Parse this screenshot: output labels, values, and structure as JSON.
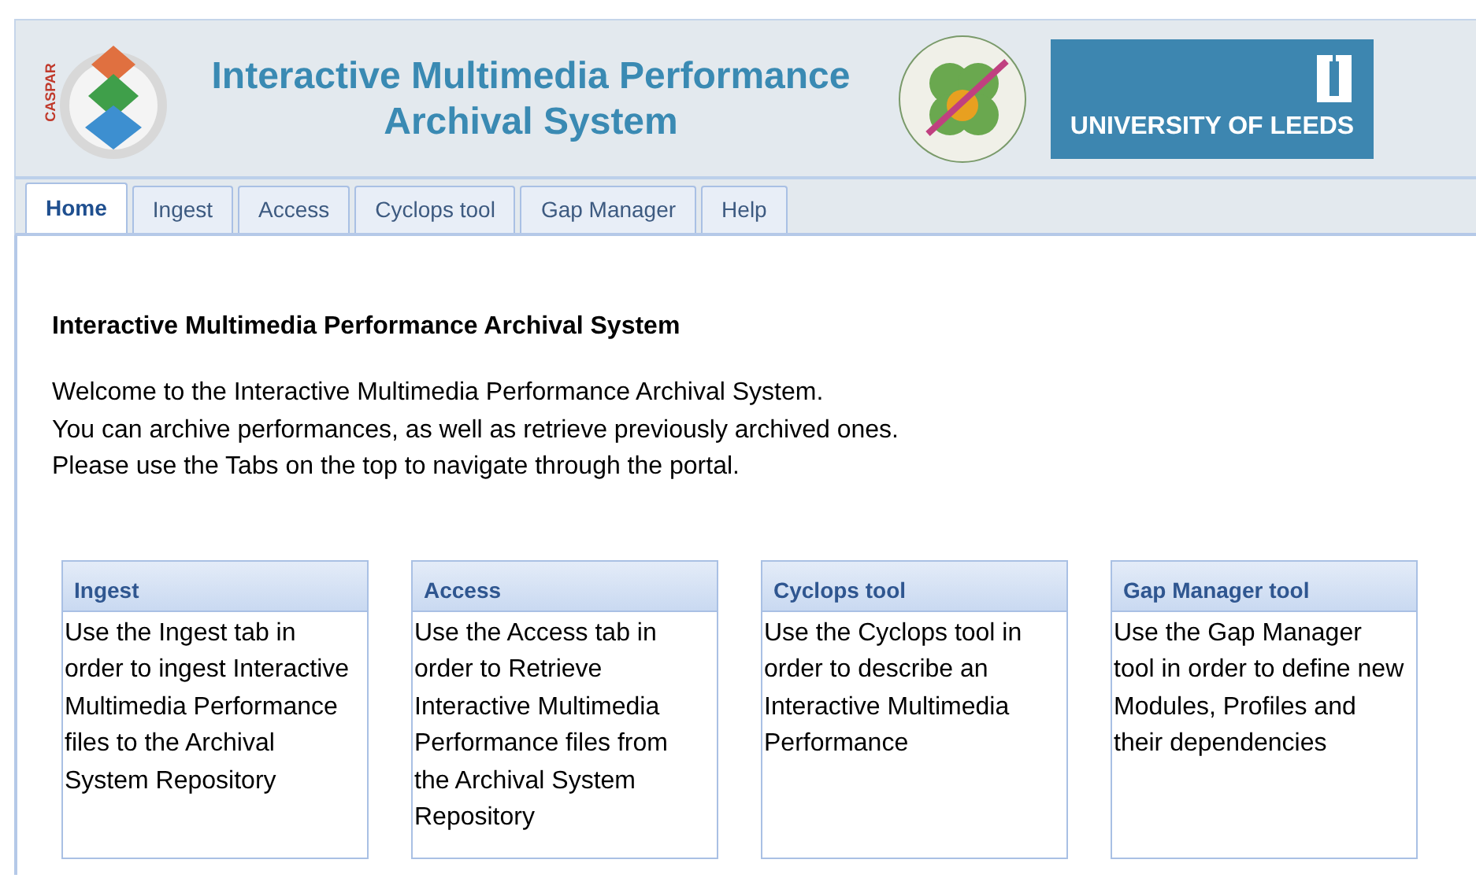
{
  "header": {
    "logo_text": "CASPAR",
    "title_lines": [
      "Interactive Multimedia Performance",
      "Archival System"
    ],
    "university": "UNIVERSITY OF LEEDS"
  },
  "tabs": [
    {
      "label": "Home",
      "selected": true
    },
    {
      "label": "Ingest",
      "selected": false
    },
    {
      "label": "Access",
      "selected": false
    },
    {
      "label": "Cyclops tool",
      "selected": false
    },
    {
      "label": "Gap Manager",
      "selected": false
    },
    {
      "label": "Help",
      "selected": false
    }
  ],
  "content": {
    "heading": "Interactive Multimedia Performance Archival System",
    "intro": [
      "Welcome to the Interactive Multimedia Performance Archival System.",
      "You can archive performances, as well as retrieve previously archived ones.",
      "Please use the Tabs on the top to navigate through the portal."
    ]
  },
  "cards": [
    {
      "title": "Ingest",
      "body": "Use the Ingest tab in order to ingest Interactive Multimedia Performance files to the Archival System Repository"
    },
    {
      "title": "Access",
      "body": "Use the Access tab in order to Retrieve Interactive Multimedia Performance files from the Archival System Repository"
    },
    {
      "title": "Cyclops tool",
      "body": "Use the Cyclops tool in order to describe an Interactive Multimedia Performance"
    },
    {
      "title": "Gap Manager tool",
      "body": "Use the Gap Manager tool in order to define new Modules, Profiles and their dependencies"
    }
  ]
}
